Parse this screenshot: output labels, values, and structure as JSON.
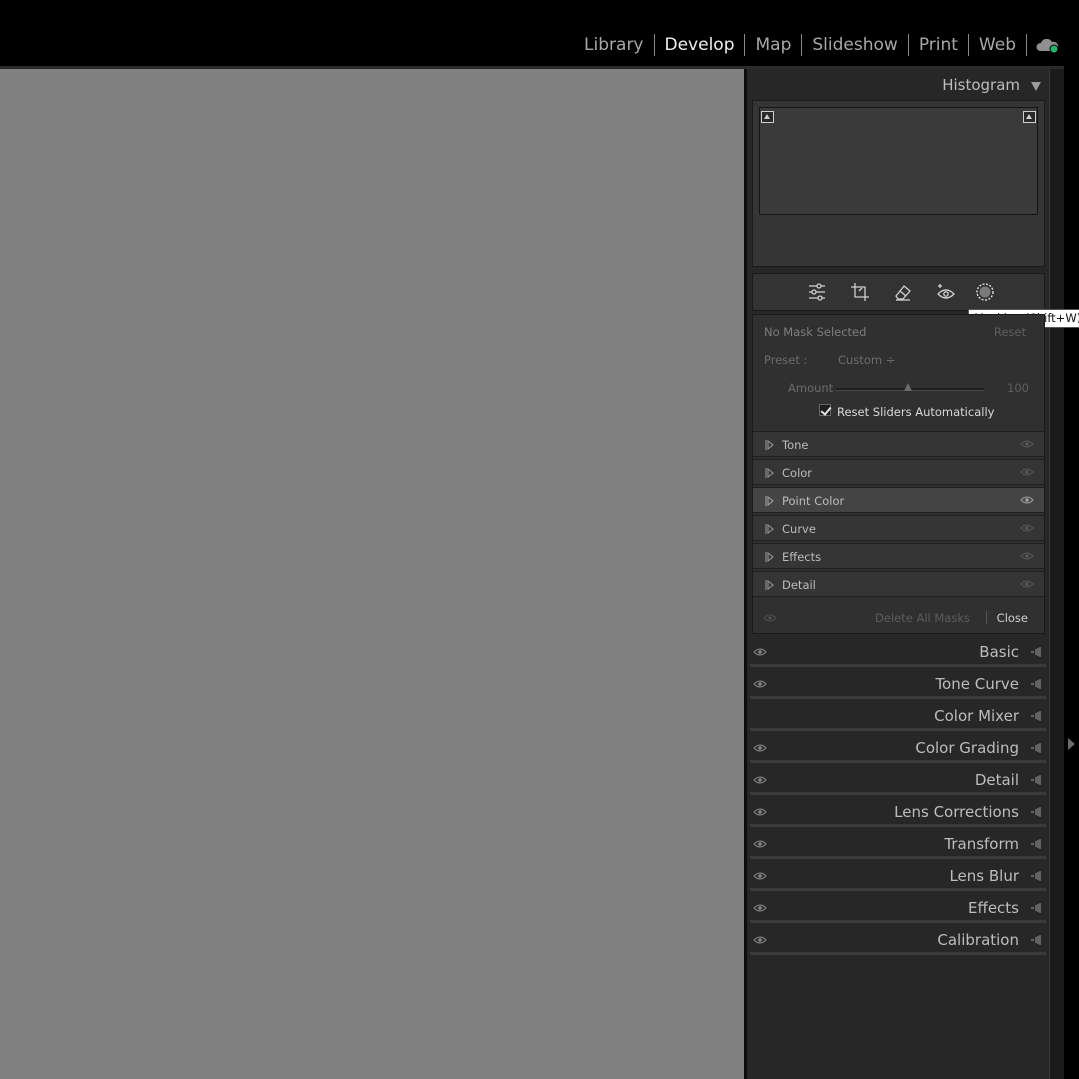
{
  "modules": [
    "Library",
    "Develop",
    "Map",
    "Slideshow",
    "Print",
    "Web"
  ],
  "active_module": "Develop",
  "histogram": {
    "title": "Histogram"
  },
  "tools": [
    "edit-sliders-icon",
    "crop-icon",
    "healing-eraser-icon",
    "red-eye-icon",
    "masking-icon"
  ],
  "tooltip": "Masking (Shift+W)",
  "mask": {
    "status": "No Mask Selected",
    "reset": "Reset",
    "preset_label": "Preset :",
    "preset_value": "Custom ÷",
    "amount_label": "Amount",
    "amount_value": "100",
    "amount_level": 0.5,
    "reset_sliders_label": "Reset Sliders Automatically",
    "reset_sliders_checked": true,
    "sections": [
      "Tone",
      "Color",
      "Point Color",
      "Curve",
      "Effects",
      "Detail"
    ],
    "highlighted_section": "Point Color",
    "delete_all": "Delete All Masks",
    "close": "Close"
  },
  "panels": [
    "Basic",
    "Tone Curve",
    "Color Mixer",
    "Color Grading",
    "Detail",
    "Lens Corrections",
    "Transform",
    "Lens Blur",
    "Effects",
    "Calibration"
  ],
  "colors": {
    "canvas": "#808080",
    "panel": "#272727",
    "active_text": "#f0f0f0",
    "cloud_status": "#27b36a"
  }
}
